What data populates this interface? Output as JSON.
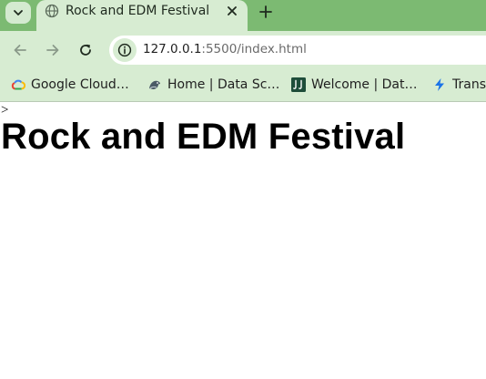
{
  "browser": {
    "tab": {
      "title": "Rock and EDM Festival",
      "favicon": "globe-icon"
    },
    "address_bar": {
      "host": "127.0.0.1",
      "rest": ":5500/index.html"
    },
    "bookmarks": [
      {
        "label": "Google Cloud…",
        "icon": "google-cloud-icon"
      },
      {
        "label": "Home | Data Sc…",
        "icon": "bird-icon"
      },
      {
        "label": "Welcome | Dat…",
        "icon": "jj-logo-icon"
      },
      {
        "label": "Trans",
        "icon": "lightning-icon"
      }
    ],
    "colors": {
      "frame": "#7cba72",
      "toolbar": "#d7ecd2"
    }
  },
  "page": {
    "stray_text": ">",
    "heading": "Rock and EDM Festival"
  }
}
